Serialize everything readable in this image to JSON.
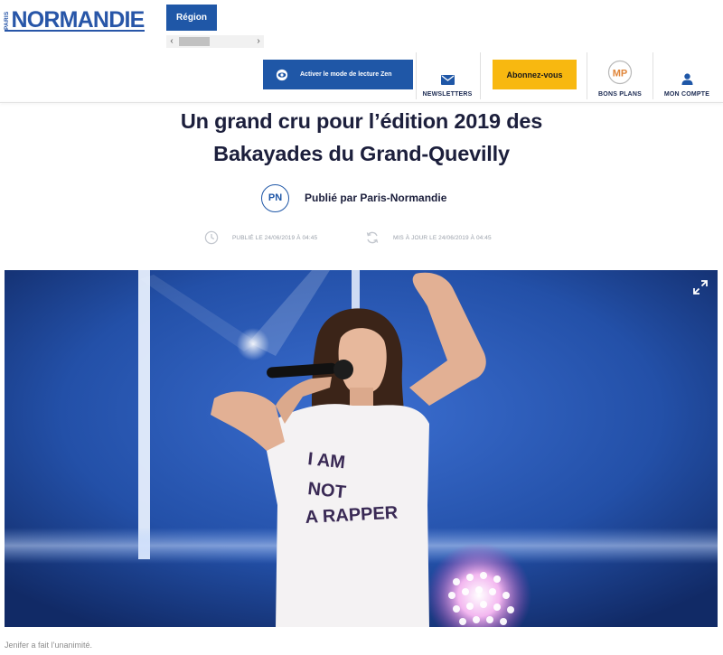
{
  "header": {
    "logo_small": "PARIS",
    "logo_main": "NORMANDIE",
    "region_label": "Région",
    "zen_label": "Activer le mode de lecture Zen",
    "newsletter_label": "NEWSLETTERS",
    "subscribe_label": "Abonnez-vous",
    "bonsplans_label": "BONS PLANS",
    "bonsplans_badge": "MP",
    "account_label": "MON COMPTE"
  },
  "article": {
    "title_line1": "Un grand cru pour l’édition 2019 des",
    "title_line2": "Bakayades du Grand-Quevilly",
    "author_badge": "PN",
    "author": "Publié par Paris-Normandie",
    "published": "PUBLIÉ LE 24/06/2019 À 04:45",
    "updated": "MIS À JOUR LE 24/06/2019 À 04:45",
    "image_tshirt_line1": "I AM",
    "image_tshirt_line2": "NOT",
    "image_tshirt_line3": "A RAPPER",
    "caption": "Jenifer a fait l’unanimité."
  },
  "colors": {
    "brand_blue": "#1f57a7",
    "subscribe_yellow": "#f8b810",
    "title_navy": "#1c1f3c"
  },
  "icons": {
    "zen": "eye-icon",
    "newsletter": "envelope-icon",
    "account": "user-icon",
    "published": "clock-icon",
    "updated": "refresh-icon",
    "fullscreen": "expand-icon"
  }
}
